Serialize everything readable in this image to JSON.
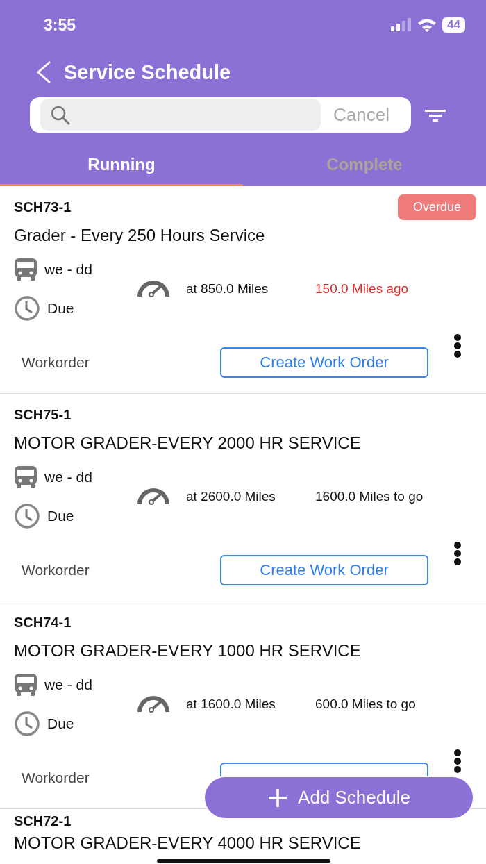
{
  "status_bar": {
    "time": "3:55",
    "battery": "44"
  },
  "header": {
    "title": "Service Schedule"
  },
  "search": {
    "cancel": "Cancel"
  },
  "tabs": [
    {
      "label": "Running",
      "selected": true
    },
    {
      "label": "Complete",
      "selected": false
    }
  ],
  "schedules": [
    {
      "kind": "full",
      "id": "SCH73-1",
      "badge": "Overdue",
      "title": "Grader - Every 250 Hours Service",
      "vehicle": "we - dd",
      "due": "Due",
      "meter": "at 850.0 Miles",
      "remaining": "150.0 Miles ago",
      "overdue": true,
      "workorder": "Workorder",
      "button": "Create Work Order"
    },
    {
      "kind": "full",
      "id": "SCH75-1",
      "title": "MOTOR GRADER-EVERY 2000 HR SERVICE",
      "vehicle": "we - dd",
      "due": "Due",
      "meter": "at 2600.0 Miles",
      "remaining": "1600.0 Miles to go",
      "overdue": false,
      "workorder": "Workorder",
      "button": "Create Work Order"
    },
    {
      "kind": "full",
      "id": "SCH74-1",
      "title": "MOTOR GRADER-EVERY 1000 HR SERVICE",
      "vehicle": "we - dd",
      "due": "Due",
      "meter": "at 1600.0 Miles",
      "remaining": "600.0 Miles to go",
      "overdue": false,
      "workorder": "Workorder"
    },
    {
      "kind": "partial",
      "id": "SCH72-1",
      "title": "MOTOR GRADER-EVERY 4000 HR SERVICE"
    }
  ],
  "fab": {
    "label": "Add Schedule"
  }
}
